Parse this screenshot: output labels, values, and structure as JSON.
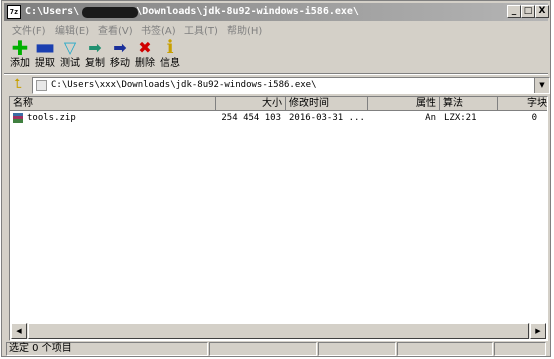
{
  "window": {
    "title_prefix": "C:\\Users\\",
    "title_suffix": "\\Downloads\\jdk-8u92-windows-i586.exe\\",
    "app_icon_text": "7z",
    "minimize": "_",
    "maximize": "□",
    "close": "X"
  },
  "menu": [
    {
      "label": "文件(F)"
    },
    {
      "label": "编辑(E)"
    },
    {
      "label": "查看(V)"
    },
    {
      "label": "书签(A)"
    },
    {
      "label": "工具(T)"
    },
    {
      "label": "帮助(H)"
    }
  ],
  "toolbar": {
    "add": {
      "label": "添加",
      "icon": "plus-icon",
      "color": "#00b000"
    },
    "extract": {
      "label": "提取",
      "icon": "minus-icon",
      "color": "#1a3fb0"
    },
    "test": {
      "label": "测试",
      "icon": "check-icon",
      "color": "#20a8c8"
    },
    "copy": {
      "label": "复制",
      "icon": "arrow-right-double-icon",
      "color": "#209070"
    },
    "move": {
      "label": "移动",
      "icon": "arrow-right-icon",
      "color": "#1a2f9a"
    },
    "delete": {
      "label": "删除",
      "icon": "x-icon",
      "color": "#d00000"
    },
    "info": {
      "label": "信息",
      "icon": "info-icon",
      "color": "#c8a000"
    }
  },
  "address": {
    "path": "C:\\Users\\xxx\\Downloads\\jdk-8u92-windows-i586.exe\\"
  },
  "columns": [
    "名称",
    "大小",
    "修改时间",
    "属性",
    "算法",
    "字块"
  ],
  "rows": [
    {
      "name": "tools.zip",
      "size": "254 454 103",
      "modified": "2016-03-31 ...",
      "attr": "An",
      "method": "LZX:21",
      "block": "0"
    }
  ],
  "status": {
    "selected": "选定 0 个项目",
    "panes": [
      "",
      "",
      "",
      ""
    ]
  }
}
